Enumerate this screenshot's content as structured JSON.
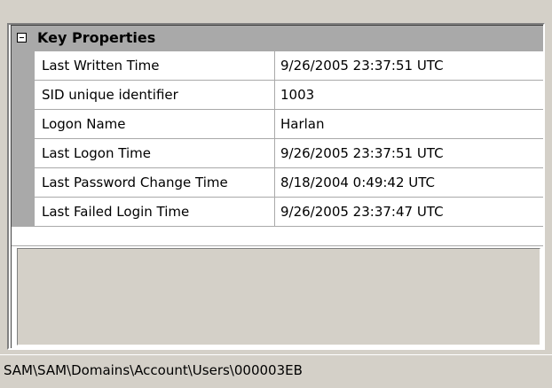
{
  "property_grid": {
    "category": {
      "label": "Key Properties",
      "expanded": true
    },
    "rows": [
      {
        "name": "Last Written Time",
        "value": "9/26/2005 23:37:51 UTC"
      },
      {
        "name": "SID unique identifier",
        "value": "1003"
      },
      {
        "name": "Logon Name",
        "value": "Harlan"
      },
      {
        "name": "Last Logon Time",
        "value": "9/26/2005 23:37:51 UTC"
      },
      {
        "name": "Last Password Change Time",
        "value": "8/18/2004 0:49:42 UTC"
      },
      {
        "name": "Last Failed Login Time",
        "value": "9/26/2005 23:37:47 UTC"
      }
    ]
  },
  "statusbar": {
    "path": "SAM\\SAM\\Domains\\Account\\Users\\000003EB"
  },
  "colors": {
    "category_band": "#a9a9a9",
    "window_face": "#d4d0c8",
    "grid_line": "#a9a9a9"
  },
  "icons": {
    "expander": "collapse-minus-icon"
  }
}
